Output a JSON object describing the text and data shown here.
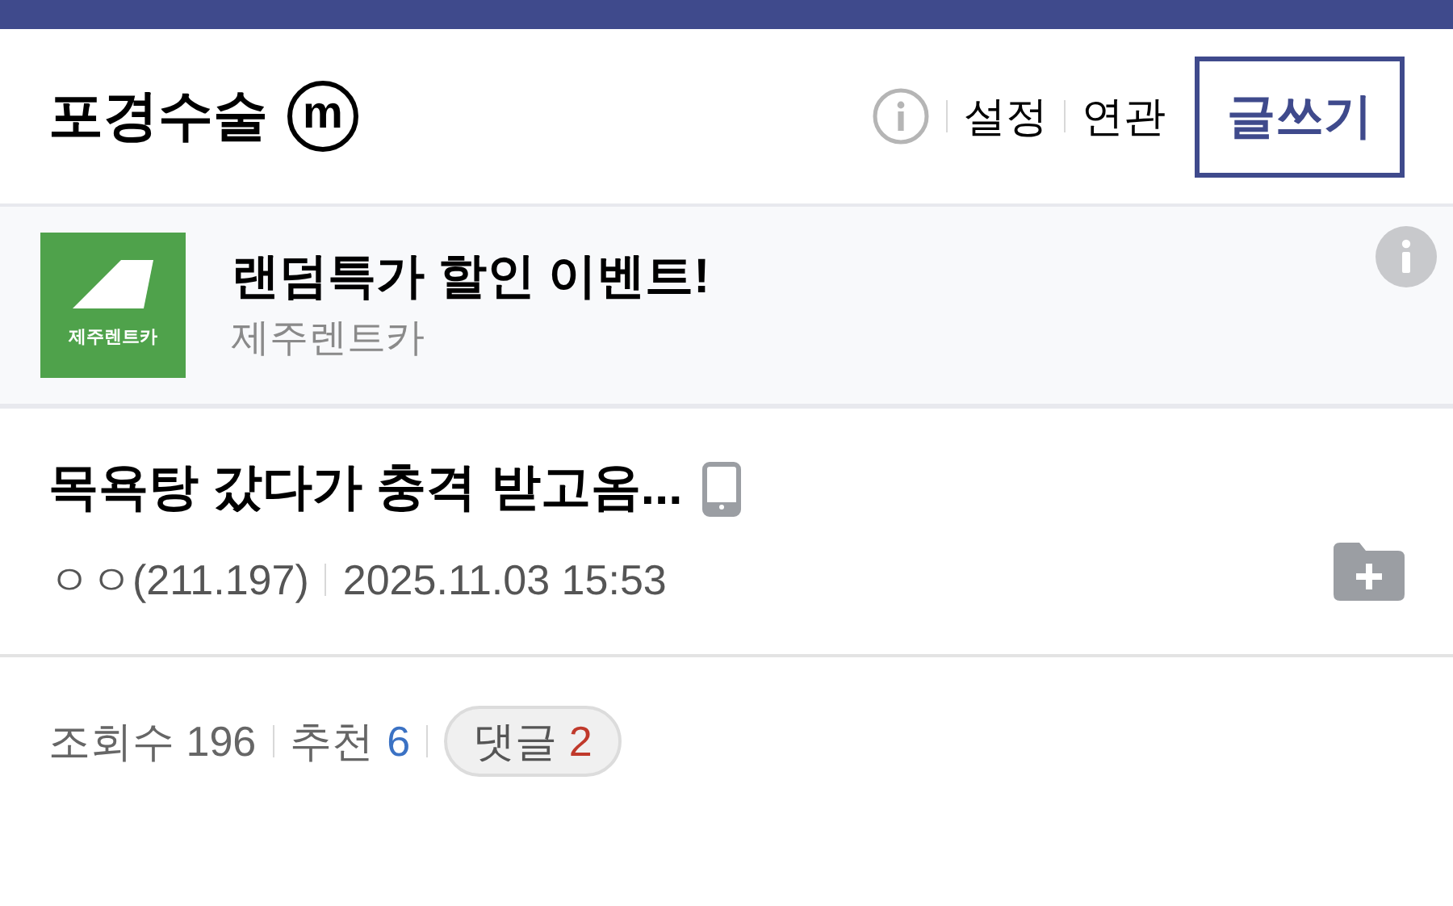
{
  "header": {
    "title": "포경수술",
    "badge": "m",
    "links": [
      "설정",
      "연관"
    ],
    "write_button": "글쓰기"
  },
  "ad": {
    "logo_text": "제주렌트카",
    "headline": "랜덤특가 할인 이벤트!",
    "advertiser": "제주렌트카"
  },
  "post": {
    "title": "목욕탕 갔다가 충격 받고옴...",
    "author": "ㅇㅇ(211.197)",
    "date": "2025.11.03 15:53"
  },
  "stats": {
    "views_label": "조회수",
    "views": "196",
    "likes_label": "추천",
    "likes": "6",
    "comments_label": "댓글",
    "comments": "2"
  }
}
